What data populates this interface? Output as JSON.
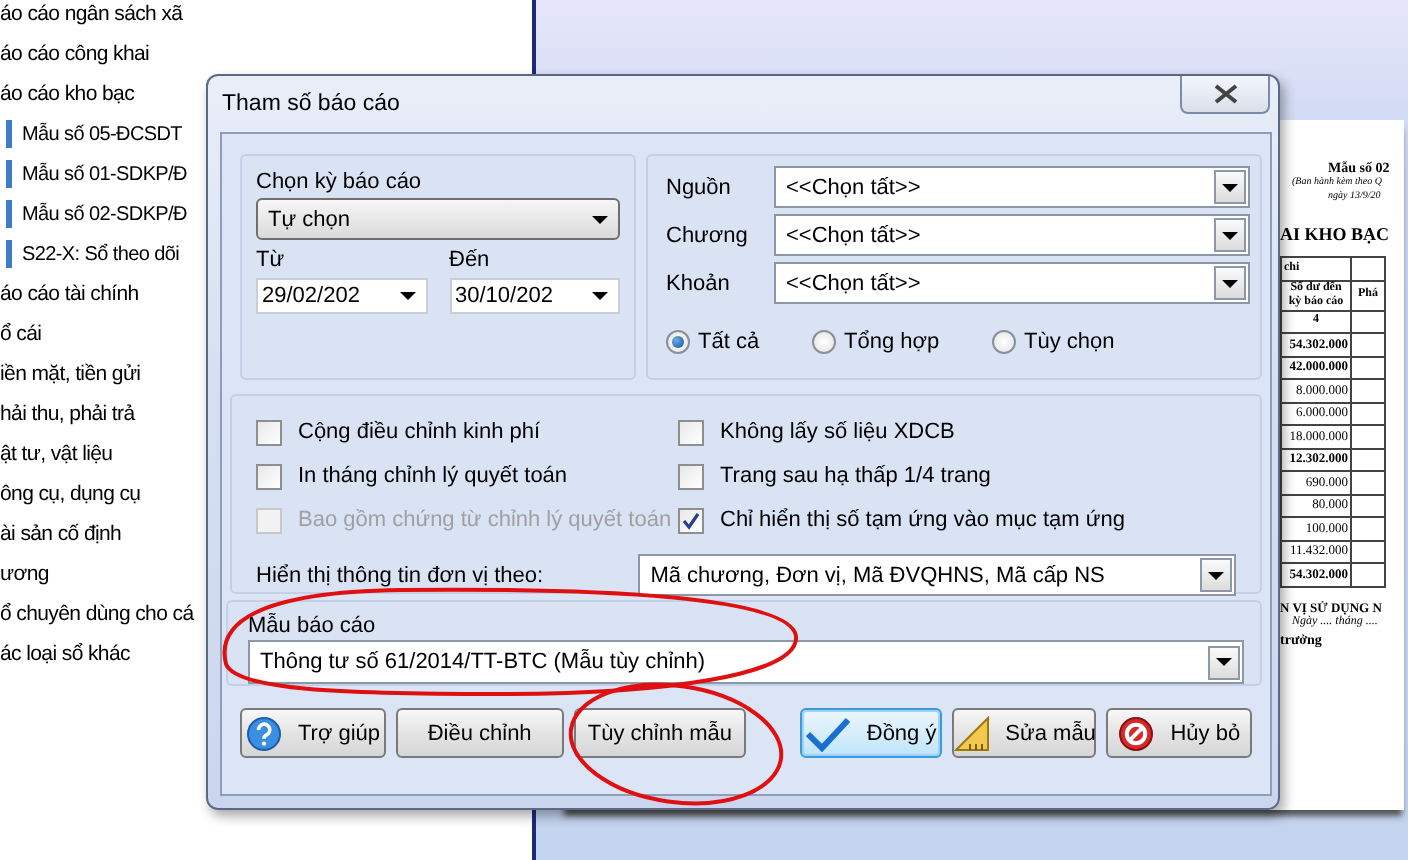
{
  "tree": {
    "items": [
      {
        "label": "áo cáo ngân sách xã"
      },
      {
        "label": "áo cáo công khai"
      },
      {
        "label": "áo cáo kho bạc",
        "children": [
          {
            "label": "Mẫu số 05-ĐCSDT"
          },
          {
            "label": "Mẫu số 01-SDKP/Đ"
          },
          {
            "label": "Mẫu số 02-SDKP/Đ"
          },
          {
            "label": "S22-X: Sổ theo dõi"
          }
        ]
      },
      {
        "label": "áo cáo tài chính"
      },
      {
        "label": "ổ cái"
      },
      {
        "label": "iền mặt, tiền gửi"
      },
      {
        "label": "hải thu, phải trả"
      },
      {
        "label": "ật tư, vật liệu"
      },
      {
        "label": "ông cụ, dụng cụ"
      },
      {
        "label": "ài sản cố định"
      },
      {
        "label": "ương"
      },
      {
        "label": "ổ chuyên dùng cho cá"
      },
      {
        "label": "ác loại sổ khác"
      }
    ]
  },
  "document": {
    "form_number": "Mẫu số 02",
    "issued_note": [
      "(Ban hành kèm theo Q",
      "ngày 13/9/20"
    ],
    "heading": "AI KHO BẠC",
    "table": {
      "group_header": "chi",
      "columns": [
        "Số dư đến kỳ báo cáo",
        "Phá"
      ],
      "index_row": "4",
      "rows": [
        {
          "value": "54.302.000",
          "bold": true
        },
        {
          "value": "42.000.000",
          "bold": true
        },
        {
          "value": "8.000.000",
          "bold": false
        },
        {
          "value": "6.000.000",
          "bold": false
        },
        {
          "value": "18.000.000",
          "bold": false
        },
        {
          "value": "12.302.000",
          "bold": true
        },
        {
          "value": "690.000",
          "bold": false
        },
        {
          "value": "80.000",
          "bold": false
        },
        {
          "value": "100.000",
          "bold": false
        },
        {
          "value": "11.432.000",
          "bold": false
        },
        {
          "value": "54.302.000",
          "bold": true
        }
      ]
    },
    "signature": {
      "unit": "N VỊ SỬ DỤNG N",
      "date": "Ngày .... tháng ....",
      "title": "trưởng"
    }
  },
  "dialog": {
    "title": "Tham số báo cáo",
    "period": {
      "label": "Chọn kỳ báo cáo",
      "value": "Tự chọn",
      "from_label": "Từ",
      "from_value": "29/02/202",
      "to_label": "Đến",
      "to_value": "30/10/202"
    },
    "filters": [
      {
        "label": "Nguồn",
        "value": "<<Chọn tất>>"
      },
      {
        "label": "Chương",
        "value": "<<Chọn tất>>"
      },
      {
        "label": "Khoản",
        "value": "<<Chọn tất>>"
      }
    ],
    "scope": [
      {
        "label": "Tất cả",
        "selected": true
      },
      {
        "label": "Tổng hợp",
        "selected": false
      },
      {
        "label": "Tùy chọn",
        "selected": false
      }
    ],
    "options": [
      {
        "label": "Cộng điều chỉnh kinh phí",
        "checked": false,
        "disabled": false
      },
      {
        "label": "Không lấy số liệu XDCB",
        "checked": false,
        "disabled": false
      },
      {
        "label": "In tháng chỉnh lý quyết toán",
        "checked": false,
        "disabled": false
      },
      {
        "label": "Trang sau hạ thấp 1/4 trang",
        "checked": false,
        "disabled": false
      },
      {
        "label": "Bao gồm chứng từ chỉnh lý quyết toán",
        "checked": false,
        "disabled": true
      },
      {
        "label": "Chỉ hiển thị số tạm ứng vào mục tạm ứng",
        "checked": true,
        "disabled": false
      }
    ],
    "unit_display": {
      "label": "Hiển thị thông tin đơn vị theo:",
      "value": "Mã chương, Đơn vị, Mã ĐVQHNS, Mã cấp NS"
    },
    "template": {
      "label": "Mẫu báo cáo",
      "value": "Thông tư số 61/2014/TT-BTC (Mẫu tùy chỉnh)"
    },
    "buttons": [
      {
        "label": "Trợ giúp",
        "kind": "help",
        "default": false
      },
      {
        "label": "Điều chỉnh",
        "kind": "plain",
        "default": false
      },
      {
        "label": "Tùy chỉnh mẫu",
        "kind": "plain",
        "default": false
      },
      {
        "label": "Đồng ý",
        "kind": "confirm",
        "default": true
      },
      {
        "label": "Sửa mẫu",
        "kind": "edit",
        "default": false
      },
      {
        "label": "Hủy bỏ",
        "kind": "cancel",
        "default": false
      }
    ]
  }
}
